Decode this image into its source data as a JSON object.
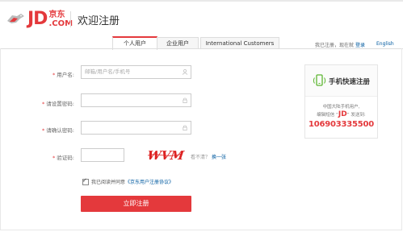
{
  "header": {
    "logo_text": "JD",
    "logo_cn": "京东",
    "logo_com": ".COM",
    "page_title": "欢迎注册"
  },
  "tabs": [
    {
      "label": "个人用户",
      "active": true
    },
    {
      "label": "企业用户",
      "active": false
    },
    {
      "label": "International Customers",
      "active": false
    }
  ],
  "top_links": {
    "have_account": "我已注册，现在就",
    "login": "登录",
    "english": "English"
  },
  "form": {
    "username": {
      "label": "用户名:",
      "placeholder": "邮箱/用户名/手机号"
    },
    "password": {
      "label": "请设置密码:",
      "placeholder": ""
    },
    "confirm": {
      "label": "请确认密码:",
      "placeholder": ""
    },
    "captcha": {
      "label": "验证码:",
      "placeholder": "",
      "image_text": "WVM",
      "hint": "看不清？",
      "refresh": "换一张"
    },
    "agree": {
      "prefix": "我已阅读并同意",
      "link": "《京东用户注册协议》",
      "checked": true
    },
    "submit_label": "立即注册"
  },
  "quick_register": {
    "title": "手机快速注册",
    "line1": "中国大陆手机用户,",
    "line2_prefix": "编辑短信 “",
    "line2_word": "JD",
    "line2_suffix": "” 发送到:",
    "number": "106903335500"
  },
  "colors": {
    "accent": "#e4393c",
    "link": "#005aa0"
  }
}
